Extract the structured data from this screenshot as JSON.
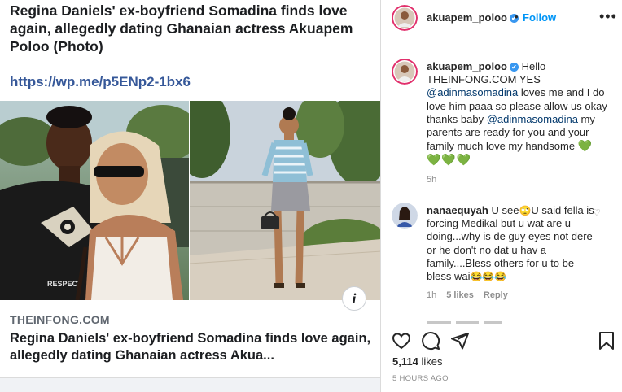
{
  "article": {
    "headline": "Regina Daniels' ex-boyfriend Somadina finds love again, allegedly dating Ghanaian actress Akuapem Poloo (Photo)",
    "link": "https://wp.me/p5ENp2-1bx6",
    "shirt_text": "RESPECT",
    "info_icon": "i",
    "source": "THEINFONG.COM",
    "preview_title": "Regina Daniels' ex-boyfriend Somadina finds love again, allegedly dating Ghanaian actress Akua..."
  },
  "post_header": {
    "username": "akuapem_poloo",
    "verified_mark": "✔",
    "separator": "•",
    "follow_label": "Follow",
    "more_label": "•••"
  },
  "caption": {
    "username": "akuapem_poloo",
    "text_1": " Hello THEINFONG.COM YES ",
    "mention_1": "@adinmasomadina",
    "text_2": " loves me and I do love him paaa so please allow us okay thanks baby ",
    "mention_2": "@adinmasomadina",
    "text_3": " my parents are ready for you and your family much love my handsome ",
    "heart_1": "💚",
    "hearts_2": "💚💚💚",
    "time": "5h"
  },
  "comment": {
    "username": "nanaequyah",
    "text_1": " U see",
    "emoji_1": "🙄",
    "text_2": "U said fella is forcing Medikal but u wat are u doing...why is de guy eyes not dere or he don't no dat u hav a family....Bless others for u to be bless wai",
    "emoji_2": "😂😂😂",
    "time": "1h",
    "likes": "5 likes",
    "reply": "Reply",
    "heart": "♡"
  },
  "actions": {
    "likes_count": "5,114",
    "likes_word": " likes",
    "time_ago": "5 HOURS AGO"
  },
  "colors": {
    "link": "#365899",
    "follow": "#0095f6",
    "verified": "#3897f0",
    "mention": "#00376b",
    "heart_green": "#22c11a",
    "muted": "#8e8e8e"
  },
  "icons": [
    "info-icon",
    "verified-icon",
    "more-icon",
    "like-icon",
    "comment-icon",
    "share-icon",
    "save-icon"
  ]
}
